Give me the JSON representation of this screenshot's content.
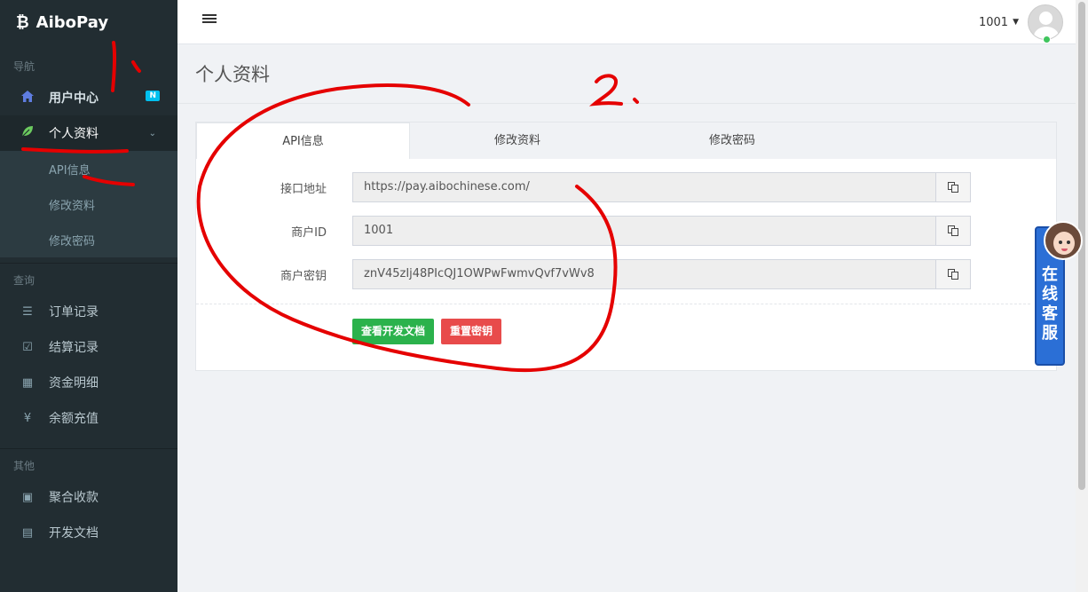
{
  "brand": {
    "name": "AiboPay",
    "icon": "bitcoin-icon"
  },
  "sidebar": {
    "sections": [
      {
        "header": "导航"
      },
      {
        "header": "查询"
      },
      {
        "header": "其他"
      }
    ],
    "nav": {
      "home": {
        "label": "用户中心",
        "icon": "home-icon",
        "badge": "N"
      },
      "profile": {
        "label": "个人资料",
        "icon": "leaf-icon"
      },
      "profile_sub": [
        {
          "label": "API信息"
        },
        {
          "label": "修改资料"
        },
        {
          "label": "修改密码"
        }
      ],
      "query": [
        {
          "label": "订单记录",
          "icon": "list-icon"
        },
        {
          "label": "结算记录",
          "icon": "check-square-icon"
        },
        {
          "label": "资金明细",
          "icon": "calendar-icon"
        },
        {
          "label": "余额充值",
          "icon": "yen-icon"
        }
      ],
      "other": [
        {
          "label": "聚合收款",
          "icon": "qrcode-icon"
        },
        {
          "label": "开发文档",
          "icon": "book-icon"
        }
      ]
    }
  },
  "topbar": {
    "user_id": "1001"
  },
  "page": {
    "title": "个人资料"
  },
  "tabs": [
    "API信息",
    "修改资料",
    "修改密码"
  ],
  "form": [
    {
      "label": "接口地址",
      "value": "https://pay.aibochinese.com/"
    },
    {
      "label": "商户ID",
      "value": "1001"
    },
    {
      "label": "商户密钥",
      "value": "znV45zIj48PIcQJ1OWPwFwmvQvf7vWv8"
    }
  ],
  "buttons": {
    "docs": "查看开发文档",
    "reset": "重置密钥"
  },
  "annotations": {
    "one": "1.",
    "two": "2."
  },
  "customer_service": {
    "label": "在线客服"
  },
  "colors": {
    "sidebar_bg": "#222d32",
    "accent_green": "#2bb24c",
    "accent_red": "#e84b4b",
    "annotation_red": "#e50000",
    "cs_blue": "#2b6fd6"
  }
}
